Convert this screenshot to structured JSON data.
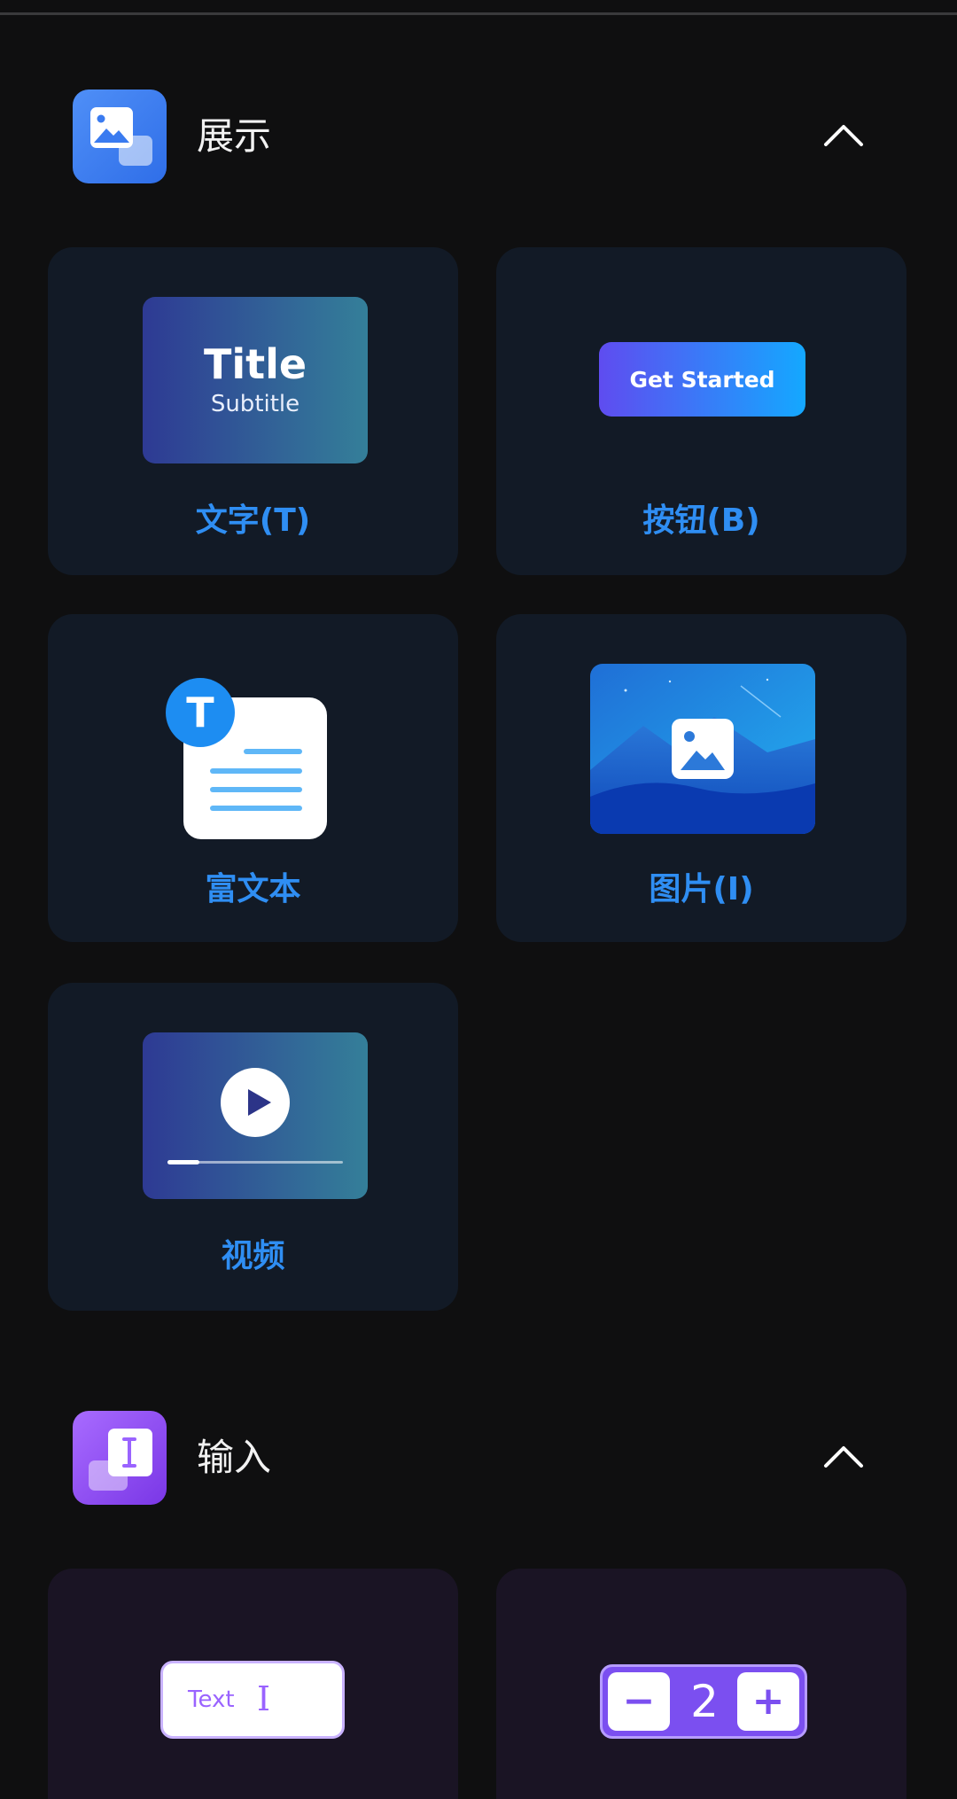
{
  "sections": [
    {
      "title": "展示",
      "icon": "image-icon",
      "items": [
        {
          "label": "文字(T)",
          "preview": {
            "title": "Title",
            "subtitle": "Subtitle"
          }
        },
        {
          "label": "按钮(B)",
          "preview": {
            "button_text": "Get Started"
          }
        },
        {
          "label": "富文本",
          "preview": {
            "badge": "T"
          }
        },
        {
          "label": "图片(I)"
        },
        {
          "label": "视频",
          "preview": {
            "progress": 0.18
          }
        }
      ]
    },
    {
      "title": "输入",
      "icon": "text-cursor-icon",
      "items": [
        {
          "label": "",
          "preview": {
            "placeholder": "Text"
          }
        },
        {
          "label": "",
          "preview": {
            "value": "2",
            "minus": "−",
            "plus": "+"
          }
        }
      ]
    }
  ],
  "colors": {
    "background": "#0f0f10",
    "card_blue": "#121a26",
    "card_purple": "#1a1424",
    "label_blue": "#2f8ef3",
    "accent_purple": "#7b4ff0"
  }
}
